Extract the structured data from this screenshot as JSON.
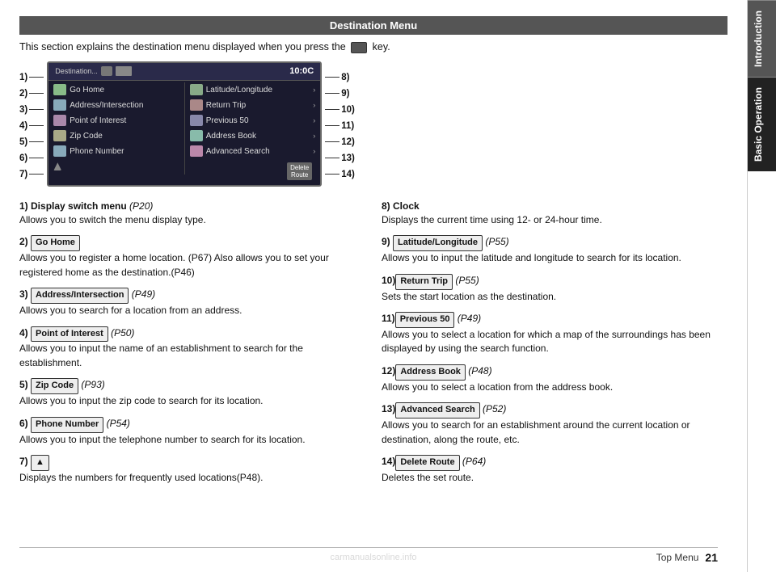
{
  "page": {
    "title": "Destination Menu",
    "intro": "This section explains the destination menu displayed when you press the",
    "key_symbol": "🔑",
    "page_number": "21",
    "footer_label": "Top Menu"
  },
  "sidebar": {
    "tabs": [
      {
        "label": "Introduction",
        "active": false
      },
      {
        "label": "Basic Operation",
        "active": true
      }
    ]
  },
  "diagram": {
    "screen_time": "10:0C",
    "left_labels": [
      "1)",
      "2)",
      "3)",
      "4)",
      "5)",
      "6)",
      "7)"
    ],
    "right_labels": [
      "8)",
      "9)",
      "10)",
      "11)",
      "12)",
      "13)",
      "14)"
    ],
    "menu_items": [
      {
        "icon": "home",
        "text": "Go Home"
      },
      {
        "icon": "map",
        "text": "Address/Intersection"
      },
      {
        "icon": "poi",
        "text": "Point of Interest"
      },
      {
        "icon": "zip",
        "text": "Zip Code"
      },
      {
        "icon": "phone",
        "text": "Phone Number"
      }
    ],
    "right_items": [
      {
        "icon": "coord",
        "text": "Latitude/Longitude"
      },
      {
        "icon": "return",
        "text": "Return Trip"
      },
      {
        "icon": "prev",
        "text": "Previous 50"
      },
      {
        "icon": "book",
        "text": "Address Book"
      },
      {
        "icon": "search",
        "text": "Advanced Search"
      }
    ],
    "delete_btn": "Delete\nRoute"
  },
  "items": [
    {
      "num": "1)",
      "title": "Display switch menu",
      "page_ref": "(P20)",
      "desc": "Allows you to switch the menu display type."
    },
    {
      "num": "2)",
      "btn": "Go Home",
      "desc": "Allows you to register a home location. (P67) Also allows you to set your registered home as the destination.(P46)"
    },
    {
      "num": "3)",
      "btn": "Address/Intersection",
      "page_ref": "(P49)",
      "desc": "Allows you to search for a location from an address."
    },
    {
      "num": "4)",
      "btn": "Point of Interest",
      "page_ref": "(P50)",
      "desc": "Allows you to input the name of an establishment to search for the establishment."
    },
    {
      "num": "5)",
      "btn": "Zip Code",
      "page_ref": "(P93)",
      "desc": "Allows you to input the zip code to search for its location."
    },
    {
      "num": "6)",
      "btn": "Phone Number",
      "page_ref": "(P54)",
      "desc": "Allows you to input the telephone number to search for its location."
    },
    {
      "num": "7)",
      "btn": "▲",
      "desc": "Displays the numbers for frequently used locations(P48)."
    },
    {
      "num": "8)",
      "title": "Clock",
      "desc": "Displays the current time using 12- or 24-hour time."
    },
    {
      "num": "9)",
      "btn": "Latitude/Longitude",
      "page_ref": "(P55)",
      "desc": "Allows you to input the latitude and longitude to search for its location."
    },
    {
      "num": "10)",
      "btn": "Return Trip",
      "page_ref": "(P55)",
      "desc": "Sets the start location as the destination."
    },
    {
      "num": "11)",
      "btn": "Previous 50",
      "page_ref": "(P49)",
      "desc": "Allows you to select a location for which a map of the surroundings has been displayed by using the search function."
    },
    {
      "num": "12)",
      "btn": "Address Book",
      "page_ref": "(P48)",
      "desc": "Allows you to select a location from the address book."
    },
    {
      "num": "13)",
      "btn": "Advanced Search",
      "page_ref": "(P52)",
      "desc": "Allows you to search for an establishment around the current location or destination, along the route, etc."
    },
    {
      "num": "14)",
      "btn": "Delete Route",
      "page_ref": "(P64)",
      "desc": "Deletes the set route."
    }
  ],
  "watermark": "carmanualsonline.info"
}
